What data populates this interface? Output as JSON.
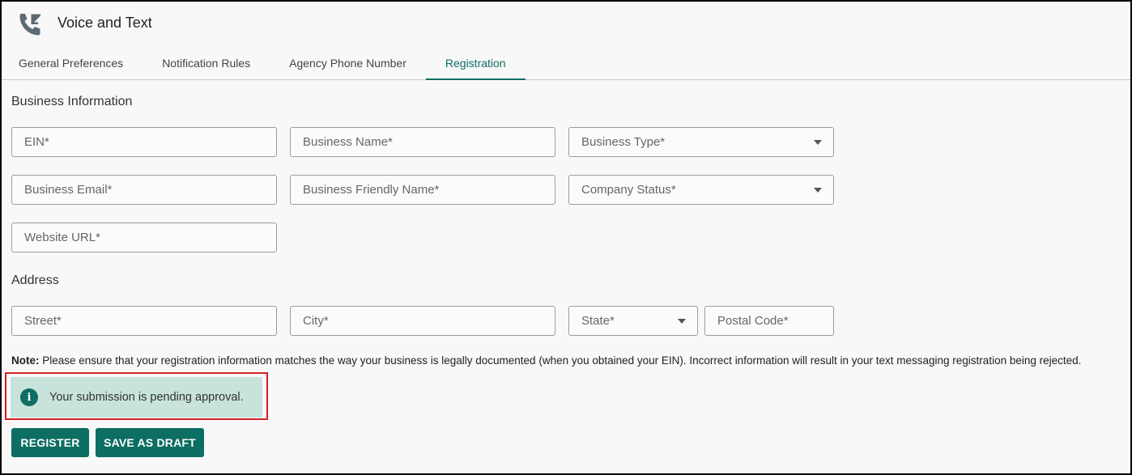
{
  "app": {
    "title": "Voice and Text",
    "icon": "phone-forward-icon"
  },
  "tabs": [
    {
      "label": "General Preferences",
      "active": false
    },
    {
      "label": "Notification Rules",
      "active": false
    },
    {
      "label": "Agency Phone Number",
      "active": false
    },
    {
      "label": "Registration",
      "active": true
    }
  ],
  "business_info": {
    "title": "Business Information",
    "ein": {
      "placeholder": "EIN*",
      "value": ""
    },
    "business_name": {
      "placeholder": "Business Name*",
      "value": ""
    },
    "business_type": {
      "placeholder": "Business Type*",
      "value": ""
    },
    "business_email": {
      "placeholder": "Business Email*",
      "value": ""
    },
    "friendly_name": {
      "placeholder": "Business Friendly Name*",
      "value": ""
    },
    "company_status": {
      "placeholder": "Company Status*",
      "value": ""
    },
    "website_url": {
      "placeholder": "Website URL*",
      "value": ""
    }
  },
  "address": {
    "title": "Address",
    "street": {
      "placeholder": "Street*",
      "value": ""
    },
    "city": {
      "placeholder": "City*",
      "value": ""
    },
    "state": {
      "placeholder": "State*",
      "value": ""
    },
    "postal_code": {
      "placeholder": "Postal Code*",
      "value": ""
    }
  },
  "note": {
    "label": "Note:",
    "text": " Please ensure that your registration information matches the way your business is legally documented (when you obtained your EIN). Incorrect information will result in your text messaging registration being rejected."
  },
  "alert": {
    "icon": "info-icon",
    "icon_glyph": "i",
    "text": "Your submission is pending approval."
  },
  "buttons": {
    "register": "REGISTER",
    "save_draft": "SAVE AS DRAFT"
  },
  "colors": {
    "accent": "#0d6e63",
    "alert_bg": "#c7e3dc",
    "highlight": "#d61f26"
  }
}
